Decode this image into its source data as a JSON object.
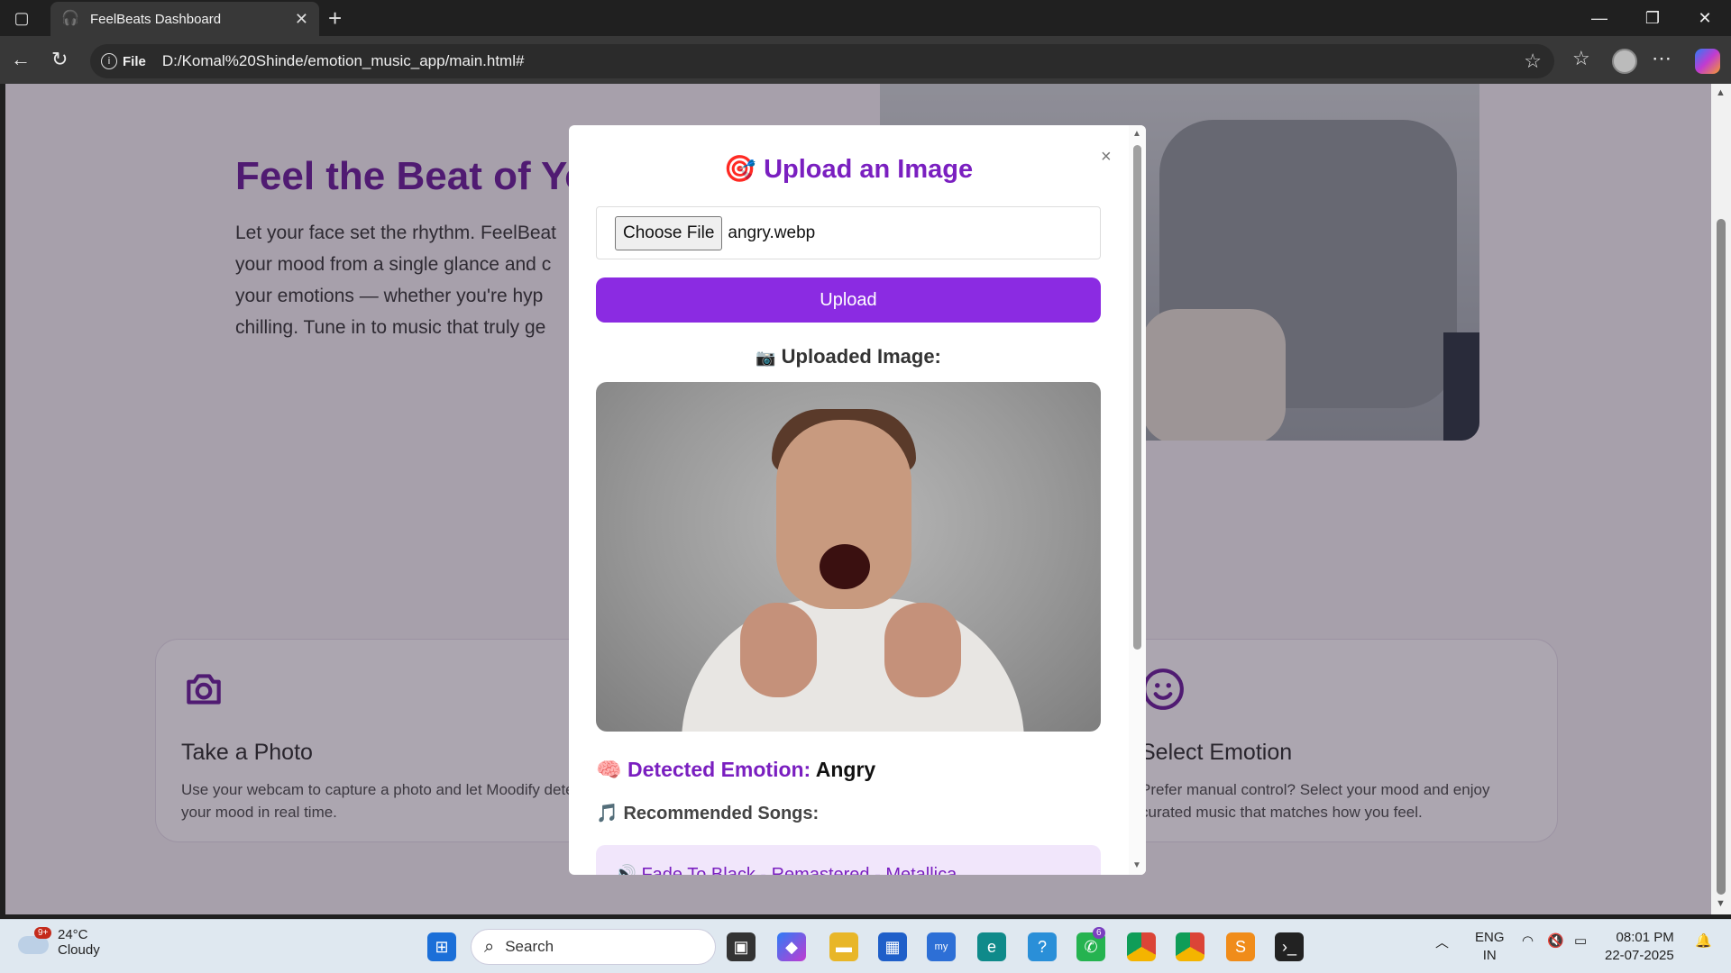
{
  "browser": {
    "tab_title": "FeelBeats Dashboard",
    "url_scheme": "File",
    "url": "D:/Komal%20Shinde/emotion_music_app/main.html#"
  },
  "page": {
    "hero_title": "Feel the Beat of Yo",
    "hero_text": "Let your face set the rhythm. FeelBeat\nyour mood from a single glance and c\nyour emotions — whether you're hyp\nchilling. Tune in to music that truly ge",
    "card_photo": {
      "title": "Take a Photo",
      "text": "Use your webcam to capture a photo and let Moodify detect your mood in real time."
    },
    "card_emotion": {
      "title": "Select Emotion",
      "text": "Prefer manual control? Select your mood and enjoy curated music that matches how you feel."
    }
  },
  "modal": {
    "close": "×",
    "title": "Upload an Image",
    "choose_file": "Choose File",
    "file_name": "angry.webp",
    "upload_button": "Upload",
    "uploaded_label": "Uploaded Image:",
    "detected_label": "Detected Emotion:",
    "detected_value": "Angry",
    "recommended_label": "Recommended Songs:",
    "song_1": "Fade To Black - Remastered - Metallica"
  },
  "taskbar": {
    "weather_temp": "24°C",
    "weather_desc": "Cloudy",
    "weather_badge": "9+",
    "search_placeholder": "Search",
    "whatsapp_badge": "6",
    "lang_1": "ENG",
    "lang_2": "IN",
    "time": "08:01 PM",
    "date": "22-07-2025"
  },
  "colors": {
    "accent": "#8b2be2",
    "heading_purple": "#6a1b9a"
  }
}
